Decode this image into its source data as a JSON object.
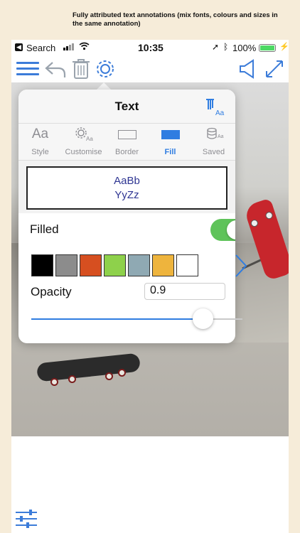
{
  "caption": "Fully attributed text annotations (mix fonts, colours and sizes in the same annotation)",
  "status_bar": {
    "back_label": "Search",
    "time": "10:35",
    "battery": "100%"
  },
  "toolbar": {
    "icons": [
      "hamburger-menu-icon",
      "undo-icon",
      "trash-icon",
      "gear-icon",
      "speaker-icon",
      "expand-icon"
    ]
  },
  "popover": {
    "title": "Text",
    "tabs": [
      {
        "label": "Style",
        "icon": "Aa"
      },
      {
        "label": "Customise",
        "icon": "gear-Aa"
      },
      {
        "label": "Border",
        "icon": "rectangle-outline"
      },
      {
        "label": "Fill",
        "icon": "filled-rectangle"
      },
      {
        "label": "Saved",
        "icon": "database-Aa"
      }
    ],
    "active_tab": "Fill",
    "preview": {
      "line1": "AaBb",
      "line2": "YyZz"
    },
    "filled_label": "Filled",
    "filled_on": true,
    "swatches": [
      "#000000",
      "#8c8c8c",
      "#d64f20",
      "#8ed14b",
      "#8fa9b3",
      "#eeb43d",
      "#ffffff"
    ],
    "opacity_label": "Opacity",
    "opacity_value": "0.9",
    "slider_fraction": 0.9
  },
  "colors": {
    "accent": "#2f7de1",
    "toggle_on": "#5fc35a"
  }
}
